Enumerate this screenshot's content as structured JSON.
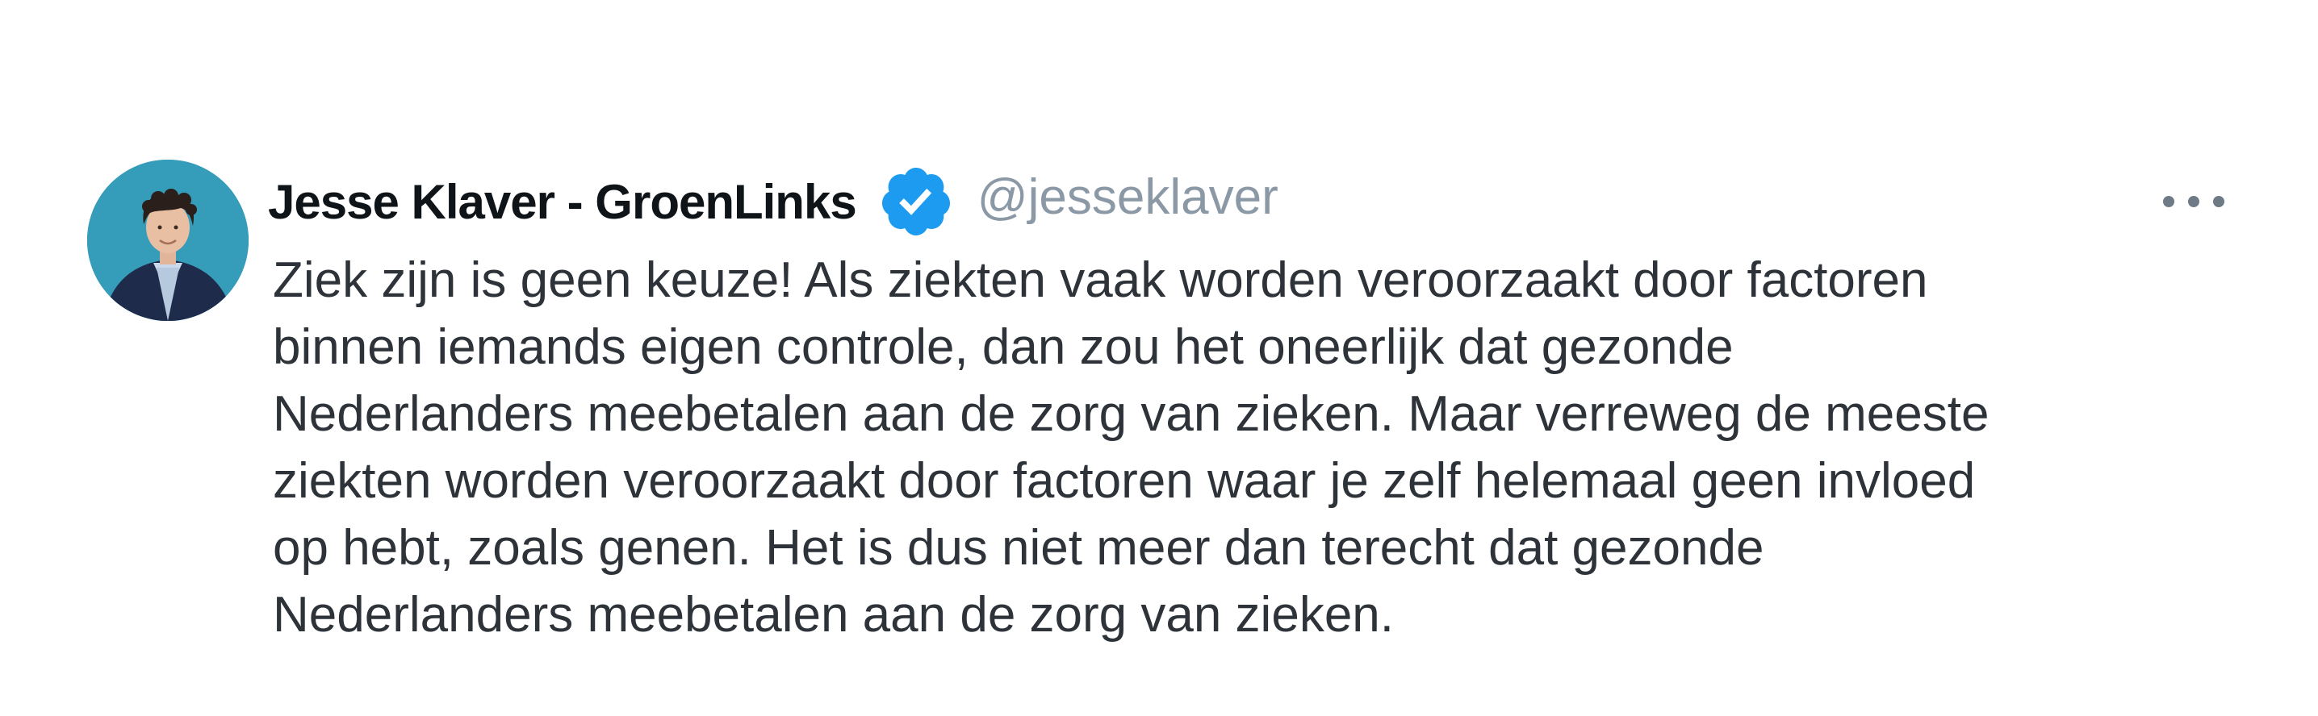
{
  "tweet": {
    "author": {
      "display_name": "Jesse Klaver - GroenLinks",
      "handle": "@jesseklaver",
      "verified_icon": "verified-badge-icon",
      "avatar": "profile-photo"
    },
    "more_icon": "more-options-icon",
    "text_lines": [
      "Ziek zijn is geen keuze! Als ziekten vaak worden veroorzaakt door factoren",
      "binnen iemands eigen controle, dan zou het oneerlijk dat gezonde",
      "Nederlanders meebetalen aan de zorg van zieken. Maar verreweg de meeste",
      "ziekten worden veroorzaakt door factoren waar je zelf helemaal geen invloed",
      "op hebt, zoals genen. Het is dus niet meer dan terecht dat gezonde",
      "Nederlanders meebetalen aan de zorg van zieken."
    ]
  },
  "colors": {
    "verified_blue": "#1d9bf0",
    "text": "#2d3339",
    "name": "#0f1419",
    "handle": "#8b98a5",
    "avatar_bg": "#3aa3bf"
  }
}
